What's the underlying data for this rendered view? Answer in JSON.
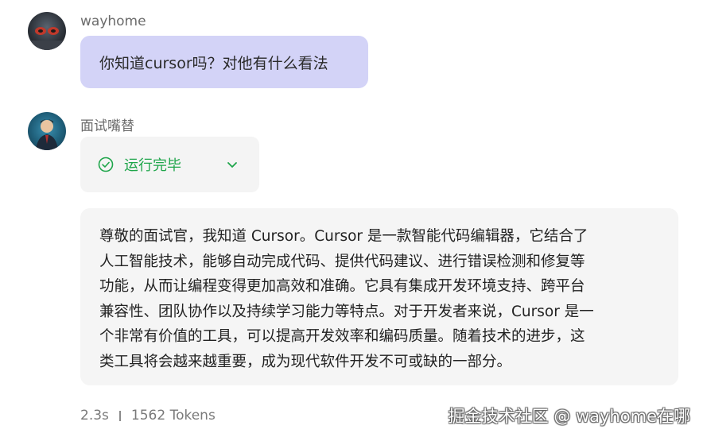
{
  "user_message": {
    "author": "wayhome",
    "text": "你知道cursor吗？对他有什么看法"
  },
  "assistant_message": {
    "author": "面试嘴替",
    "status": {
      "label": "运行完毕",
      "color": "#1ea54a",
      "icon": "check-circle-icon",
      "expand_icon": "chevron-down-icon"
    },
    "answer_lines": [
      "尊敬的面试官，我知道 Cursor。Cursor 是一款智能代码编辑器，它结合了",
      "人工智能技术，能够自动完成代码、提供代码建议、进行错误检测和修复等",
      "功能，从而让编程变得更加高效和准确。它具有集成开发环境支持、跨平台",
      "兼容性、团队协作以及持续学习能力等特点。对于开发者来说，Cursor 是一",
      "个非常有价值的工具，可以提高开发效率和编码质量。随着技术的进步，这",
      "类工具将会越来越重要，成为现代软件开发不可或缺的一部分。"
    ],
    "duration": "2.3s",
    "tokens": "1562 Tokens"
  },
  "watermark": "掘金技术社区 @ wayhome在哪",
  "colors": {
    "user_bubble": "#d3d3f7",
    "answer_bg": "#f5f5f5"
  }
}
